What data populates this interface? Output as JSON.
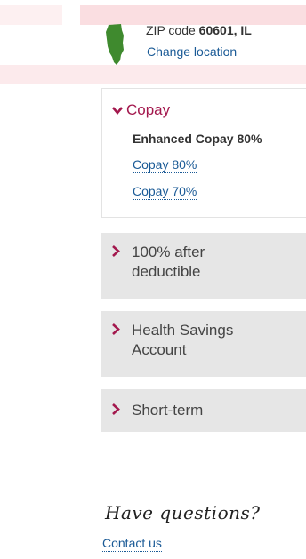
{
  "location": {
    "zip_prefix": "ZIP code ",
    "zip_value": "60601, IL",
    "change_label": "Change location",
    "state_icon": "illinois-state-icon",
    "state_color": "#3f8a2e"
  },
  "plans": {
    "expanded_section": {
      "label": "Copay",
      "selected": "Enhanced Copay 80%",
      "options": [
        "Copay 80%",
        "Copay 70%"
      ]
    },
    "collapsed_sections": [
      {
        "label_line1": "100% after",
        "label_line2": "deductible"
      },
      {
        "label_line1": "Health Savings",
        "label_line2": "Account"
      },
      {
        "label_line1": "Short-term",
        "label_line2": ""
      }
    ]
  },
  "help": {
    "heading": "Have questions?",
    "contact_label": "Contact us"
  },
  "colors": {
    "accent": "#a3184d",
    "link": "#1a5a96",
    "panel_bg": "#e6e6e6"
  }
}
